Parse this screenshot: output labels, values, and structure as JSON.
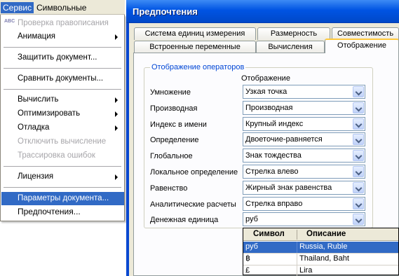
{
  "menubar": {
    "items": [
      "Сервис",
      "Символьные операции"
    ]
  },
  "menu": {
    "spell_icon_text": "ABC",
    "spell": "Проверка правописания",
    "animation": "Анимация",
    "protect": "Защитить документ...",
    "compare": "Сравнить документы...",
    "calculate": "Вычислить",
    "optimize": "Оптимизировать",
    "debug": "Отладка",
    "disable_calc": "Отключить вычисление",
    "trace": "Трассировка ошибок",
    "license": "Лицензия",
    "doc_params": "Параметры документа...",
    "preferences": "Предпочтения..."
  },
  "dialog": {
    "title": "Предпочтения",
    "tabs": {
      "units": "Система единиц измерения",
      "dimension": "Размерность",
      "compat": "Совместимость",
      "builtin": "Встроенные переменные",
      "calc": "Вычисления",
      "display": "Отображение"
    },
    "group_title": "Отображение операторов",
    "column_header": "Отображение",
    "rows": [
      {
        "label": "Умножение",
        "value": "Узкая точка"
      },
      {
        "label": "Производная",
        "value": "Производная"
      },
      {
        "label": "Индекс в имени",
        "value": "Крупный индекс"
      },
      {
        "label": "Определение",
        "value": "Двоеточие-равняется"
      },
      {
        "label": "Глобальное",
        "value": "Знак тождества"
      },
      {
        "label": "Локальное определение",
        "value": "Стрелка влево"
      },
      {
        "label": "Равенство",
        "value": "Жирный знак равенства"
      },
      {
        "label": "Аналитические расчеты",
        "value": "Стрелка вправо"
      },
      {
        "label": "Денежная единица",
        "value": "руб"
      }
    ],
    "currency_list": {
      "headers": {
        "symbol": "Символ",
        "description": "Описание"
      },
      "rows": [
        {
          "symbol": "руб",
          "description": "Russia, Ruble"
        },
        {
          "symbol": "฿",
          "description": "Thailand, Baht"
        },
        {
          "symbol": "£",
          "description": "Lira"
        }
      ]
    }
  },
  "colors": {
    "selection": "#316ac5",
    "title_bar": "#0054e3",
    "group_title": "#0046d5",
    "disabled_text": "#a7a6aa"
  }
}
